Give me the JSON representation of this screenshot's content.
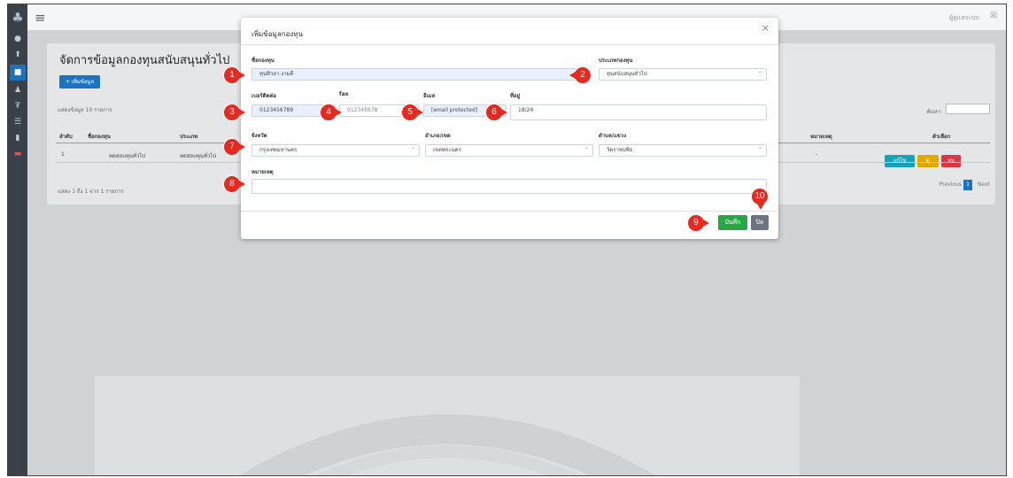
{
  "topbar": {
    "user": "ผู้ดูแลระบบ",
    "close": "☒"
  },
  "page": {
    "title": "จัดการข้อมูลกองทุนสนับสนุนทั่วไป",
    "add_button": "+ เพิ่มข้อมูล",
    "show_entries": "แสดงข้อมูล 10 รายการ",
    "search_label": "ค้นหา:",
    "table_headers": [
      "ลำดับ",
      "ชื่อกองทุน",
      "ประเภท",
      "หมายเหตุ",
      "ตัวเลือก"
    ],
    "row": [
      "1",
      "ทดสอบทุนทั่วไป",
      "ทดสอบทุนทั่วไป",
      "-"
    ],
    "row_actions": [
      "แก้ไข",
      "ดู",
      "ลบ"
    ],
    "showing": "แสดง 1 ถึง 1 จาก 1 รายการ",
    "prev": "Previous",
    "page_num": "1",
    "next": "Next"
  },
  "modal": {
    "title": "เพิ่มข้อมูลกองทุน",
    "close_icon": "×",
    "fields": {
      "fund_name_label": "ชื่อกองทุน",
      "fund_name_value": "ทุนทิวอา งามดี",
      "fund_type_label": "ประเภทกองทุน",
      "fund_type_value": "ทุนสนับสนุนทั่วไป",
      "phone_label": "เบอร์ติดต่อ",
      "phone_value": "0123456789",
      "fax_label": "fax",
      "fax_value": "012345678",
      "email_label": "อีเมล",
      "email_value": "[email protected]",
      "address_label": "ที่อยู่",
      "address_value": "18/24",
      "province_label": "จังหวัด",
      "province_value": "กรุงเทพมหานคร",
      "district_label": "อำเภอ/เขต",
      "district_value": "เขตพระนคร",
      "subdistrict_label": "ตำบล/แขวง",
      "subdistrict_value": "วัดราชบพิธ",
      "note_label": "หมายเหตุ"
    },
    "save_button": "บันทึก",
    "close_button": "ปิด"
  },
  "markers": [
    "1",
    "2",
    "3",
    "4",
    "5",
    "6",
    "7",
    "8",
    "9",
    "10"
  ]
}
